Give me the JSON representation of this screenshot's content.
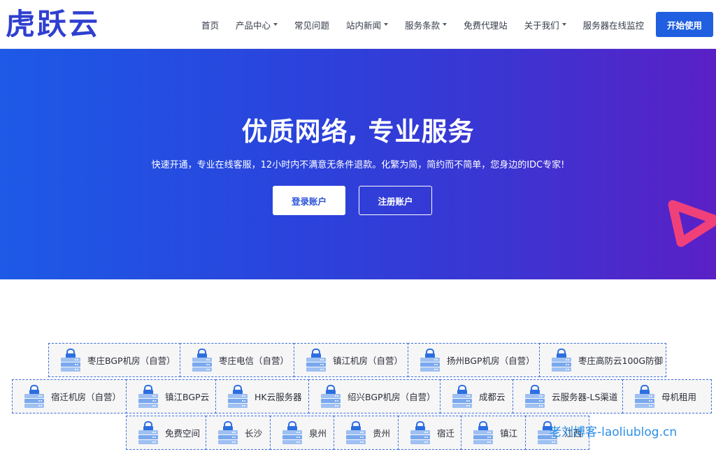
{
  "header": {
    "logo": "虎跃云",
    "nav": [
      {
        "label": "首页",
        "dropdown": false
      },
      {
        "label": "产品中心",
        "dropdown": true
      },
      {
        "label": "常见问题",
        "dropdown": false
      },
      {
        "label": "站内新闻",
        "dropdown": true
      },
      {
        "label": "服务条款",
        "dropdown": true
      },
      {
        "label": "免费代理站",
        "dropdown": false
      },
      {
        "label": "关于我们",
        "dropdown": true
      },
      {
        "label": "服务器在线监控",
        "dropdown": false
      }
    ],
    "cta": "开始使用"
  },
  "hero": {
    "title": "优质网络, 专业服务",
    "subtitle": "快速开通，专业在线客服，12小时内不满意无条件退款。化繁为简，简约而不简单，您身边的IDC专家!",
    "login": "登录账户",
    "register": "注册账户"
  },
  "datacenters": [
    [
      "枣庄BGP机房（自营）",
      "枣庄电信（自营）",
      "镇江机房（自营）",
      "扬州BGP机房（自营）",
      "枣庄高防云100G防御"
    ],
    [
      "宿迁机房（自营）",
      "镇江BGP云",
      "HK云服务器",
      "绍兴BGP机房（自营）",
      "成都云",
      "云服务器-LS渠道",
      "母机租用"
    ],
    [
      "免费空间",
      "长沙",
      "泉州",
      "贵州",
      "宿迁",
      "镇江",
      "江西"
    ]
  ],
  "watermark": "老刘博客-laoliublog.cn",
  "colors": {
    "brand": "#2f3fd0",
    "cta": "#1f5fe0",
    "hero_start": "#1d5ae6",
    "hero_end": "#5a20c6",
    "card_border": "#3d6fd6",
    "deco": "#f0407a"
  }
}
